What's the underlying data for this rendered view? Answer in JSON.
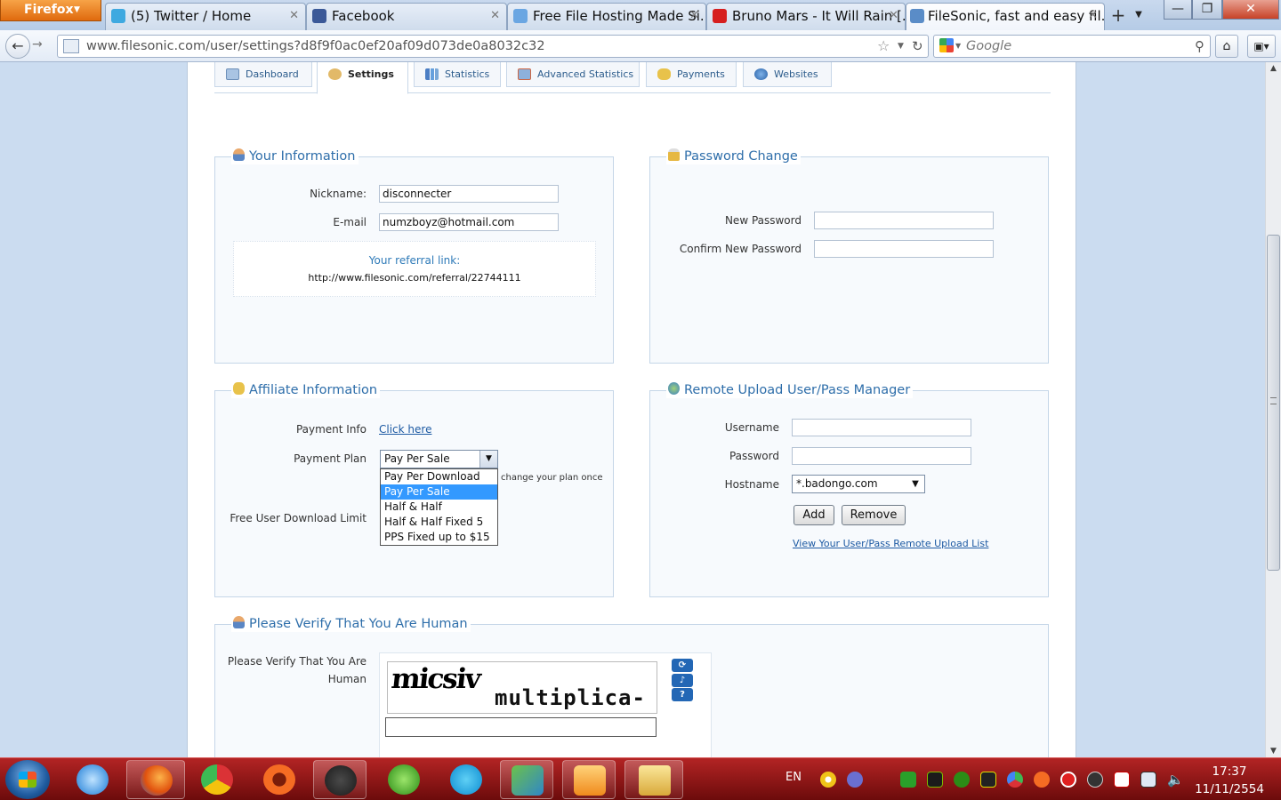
{
  "browser": {
    "app_button": "Firefox",
    "tabs": [
      {
        "label": "(5) Twitter / Home"
      },
      {
        "label": "Facebook"
      },
      {
        "label": "Free File Hosting Made Si..."
      },
      {
        "label": "Bruno Mars - It Will Rain [..."
      },
      {
        "label": "FileSonic, fast and easy fil..."
      }
    ],
    "url": "www.filesonic.com/user/settings?d8f9f0ac0ef20af09d073de0a8032c32",
    "search_placeholder": "Google"
  },
  "site_tabs": [
    {
      "label": "Dashboard"
    },
    {
      "label": "Settings"
    },
    {
      "label": "Statistics"
    },
    {
      "label": "Advanced Statistics"
    },
    {
      "label": "Payments"
    },
    {
      "label": "Websites"
    }
  ],
  "your_info": {
    "title": "Your Information",
    "nickname_label": "Nickname:",
    "nickname_value": "disconnecter",
    "email_label": "E-mail",
    "email_value": "numzboyz@hotmail.com",
    "referral_title": "Your referral link:",
    "referral_url": "http://www.filesonic.com/referral/22744111"
  },
  "password_change": {
    "title": "Password Change",
    "new_label": "New Password",
    "confirm_label": "Confirm New Password"
  },
  "affiliate": {
    "title": "Affiliate Information",
    "payment_info_label": "Payment Info",
    "payment_info_link": "Click here",
    "payment_plan_label": "Payment Plan",
    "payment_plan_value": "Pay Per Sale",
    "plan_options": [
      "Pay Per Download",
      "Pay Per Sale",
      "Half & Half",
      "Half & Half Fixed 5",
      "PPS Fixed up to $15"
    ],
    "selected_option_index": 1,
    "note_text": "change your plan once",
    "free_limit_label": "Free User Download Limit"
  },
  "remote_upload": {
    "title": "Remote Upload User/Pass Manager",
    "username_label": "Username",
    "password_label": "Password",
    "hostname_label": "Hostname",
    "hostname_value": "*.badongo.com",
    "add_button": "Add",
    "remove_button": "Remove",
    "list_link": "View Your User/Pass Remote Upload List"
  },
  "verify": {
    "title": "Please Verify That You Are Human",
    "label_line1": "Please Verify That You Are",
    "label_line2": "Human",
    "captcha_word1": "micsiv",
    "captcha_word2": "multiplica-"
  },
  "taskbar": {
    "language": "EN",
    "time": "17:37",
    "date": "11/11/2554"
  }
}
